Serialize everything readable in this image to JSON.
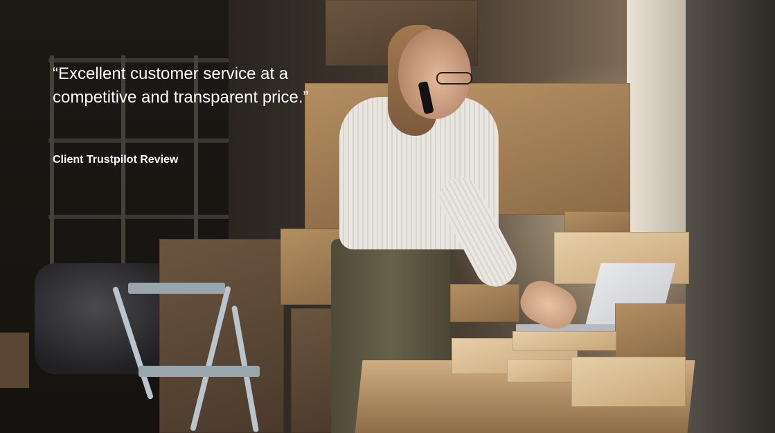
{
  "hero": {
    "quote": "“Excellent customer service at a competitive and transparent price.”",
    "source": "Client Trustpilot Review"
  },
  "colors": {
    "text": "#ffffff",
    "background": "#1a1714"
  }
}
